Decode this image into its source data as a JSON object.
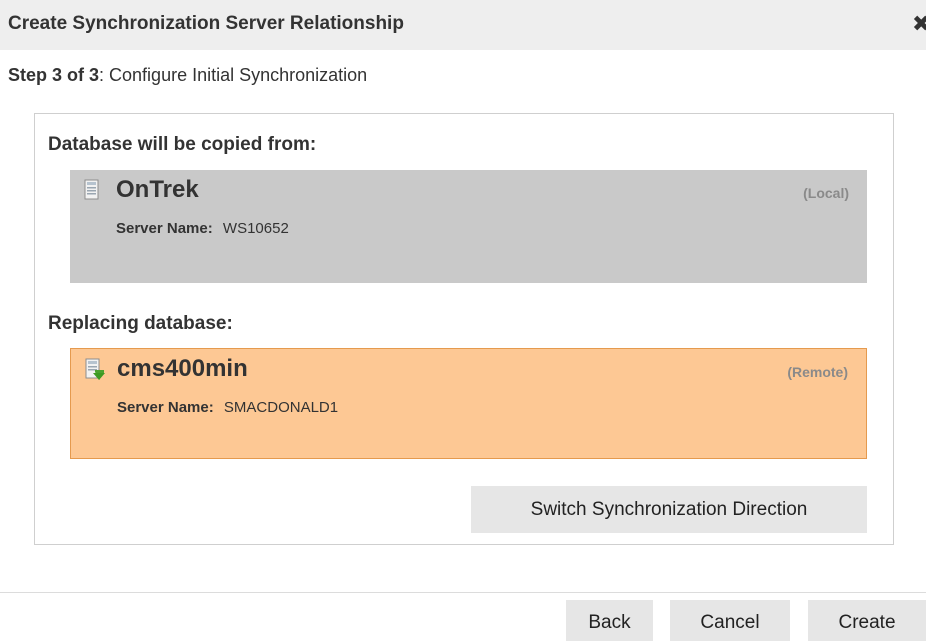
{
  "dialog": {
    "title": "Create Synchronization Server Relationship",
    "close_glyph": "✖"
  },
  "step": {
    "prefix": "Step 3 of 3",
    "text": ": Configure Initial Synchronization"
  },
  "source": {
    "heading": "Database will be copied from:",
    "name": "OnTrek",
    "tag": "(Local)",
    "server_label": "Server Name:",
    "server_value": "WS10652",
    "icon": "database-server-icon",
    "background": "#c9c9c9"
  },
  "target": {
    "heading": "Replacing database:",
    "name": "cms400min",
    "tag": "(Remote)",
    "server_label": "Server Name:",
    "server_value": "SMACDONALD1",
    "icon": "database-server-arrow-icon",
    "background": "#fdc894"
  },
  "actions": {
    "switch_label": "Switch Synchronization Direction",
    "back_label": "Back",
    "cancel_label": "Cancel",
    "create_label": "Create"
  }
}
